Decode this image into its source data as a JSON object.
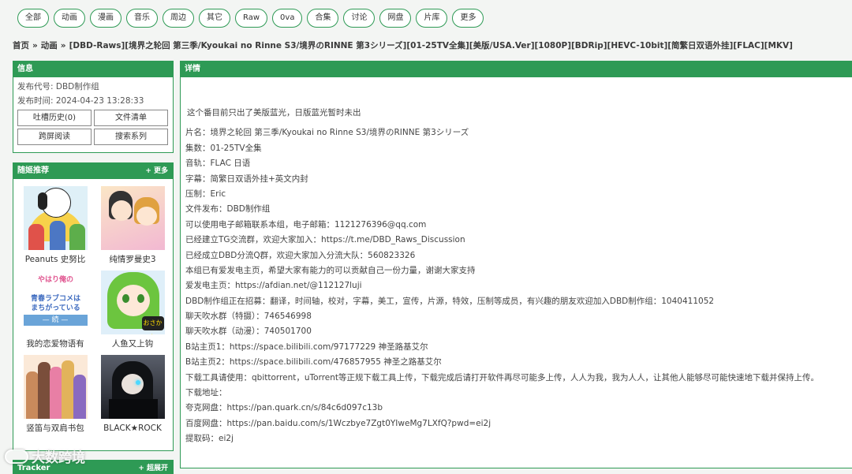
{
  "nav": {
    "items": [
      "全部",
      "动画",
      "漫画",
      "音乐",
      "周边",
      "其它",
      "Raw",
      "0va",
      "合集",
      "讨论",
      "网盘",
      "片库",
      "更多"
    ]
  },
  "breadcrumb": {
    "home": "首页",
    "category": "动画",
    "title": "[DBD-Raws][境界之轮回 第三季/Kyoukai no Rinne S3/境界のRINNE 第3シリーズ][01-25TV全集][美版/USA.Ver][1080P][BDRip][HEVC-10bit][简繁日双语外挂][FLAC][MKV]"
  },
  "info": {
    "header": "信息",
    "publisher": "发布代号: DBD制作组",
    "time": "发布时间: 2024-04-23 13:28:33",
    "buttons": [
      "吐槽历史(0)",
      "文件清单",
      "跨屏阅读",
      "搜索系列"
    ]
  },
  "recommend": {
    "header": "随姬推荐",
    "more": "+ 更多",
    "items": [
      {
        "title": "Peanuts 史努比",
        "thumb": "snoopy-cover"
      },
      {
        "title": "纯情罗曼史3",
        "thumb": "junjou-cover"
      },
      {
        "title": "我的恋爱物语有",
        "thumb": "oregairu-cover",
        "thumb_text1": "やはり俺の",
        "thumb_text2": "青春ラブコメは まちがっている",
        "thumb_band": "— 続 —"
      },
      {
        "title": "人鱼又上钩",
        "thumb": "mermaid-cover",
        "thumb_mark": "おさかな"
      },
      {
        "title": "竖笛与双肩书包",
        "thumb": "recorder-cover"
      },
      {
        "title": "BLACK★ROCK",
        "thumb": "brs-cover"
      }
    ]
  },
  "tracker": {
    "header": "Tracker",
    "more": "+ 超展开"
  },
  "detail": {
    "header": "详情",
    "notice": "这个番目前只出了美版蓝光，日版蓝光暂时未出",
    "lines": [
      "片名：境界之轮回 第三季/Kyoukai no Rinne S3/境界のRINNE 第3シリーズ",
      "集数：01-25TV全集",
      "音轨：FLAC 日语",
      "字幕：简繁日双语外挂+英文内封",
      "压制：Eric",
      "文件发布：DBD制作组",
      "可以使用电子邮箱联系本组，电子邮箱：1121276396@qq.com",
      "已经建立TG交流群，欢迎大家加入：https://t.me/DBD_Raws_Discussion",
      "已经成立DBD分流Q群，欢迎大家加入分流大队：560823326",
      "本组已有爱发电主页，希望大家有能力的可以贡献自己一份力量，谢谢大家支持",
      "爱发电主页：https://afdian.net/@112127luji",
      "DBD制作组正在招募：翻译，时间轴，校对，字幕，美工，宣传，片源，特效，压制等成员，有兴趣的朋友欢迎加入DBD制作组：1040411052",
      "聊天吹水群（特摄）：746546998",
      "聊天吹水群（动漫）：740501700",
      "B站主页1：https://space.bilibili.com/97177229 神圣路基艾尔",
      "B站主页2：https://space.bilibili.com/476857955 神圣之路基艾尔",
      "下载工具请使用：qbittorrent，uTorrent等正规下载工具上传，下载完成后请打开软件再尽可能多上传，人人为我，我为人人，让其他人能够尽可能快速地下载并保持上传。",
      "下载地址：",
      "夸克网盘：https://pan.quark.cn/s/84c6d097c13b",
      "百度网盘：https://pan.baidu.com/s/1Wczbye7Zgt0YIweMg7LXfQ?pwd=ei2j",
      "提取码：ei2j"
    ]
  },
  "watermark": "大数跨境",
  "colors": {
    "accent": "#2e9a55",
    "background": "#f3f5f3"
  }
}
